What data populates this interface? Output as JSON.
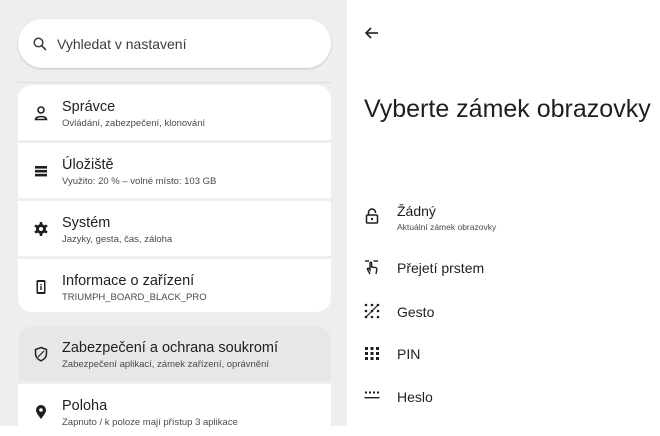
{
  "search": {
    "placeholder": "Vyhledat v nastavení",
    "icon": "search-icon"
  },
  "sidebar": {
    "items": [
      {
        "title": "Správce",
        "subtitle": "Ovládání, zabezpečení, klonování",
        "icon": "person-icon"
      },
      {
        "title": "Úložiště",
        "subtitle": "Využito: 20 % – volné místo: 103 GB",
        "icon": "storage-icon"
      },
      {
        "title": "Systém",
        "subtitle": "Jazyky, gesta, čas, záloha",
        "icon": "gear-icon"
      },
      {
        "title": "Informace o zařízení",
        "subtitle": "TRIUMPH_BOARD_BLACK_PRO",
        "icon": "device-info-icon"
      },
      {
        "title": "Zabezpečení a ochrana soukromí",
        "subtitle": "Zabezpečení aplikací, zámek zařízení, oprávnění",
        "icon": "shield-icon",
        "active": true
      },
      {
        "title": "Poloha",
        "subtitle": "Zapnuto / k poloze mají přístup 3 aplikace",
        "icon": "location-icon"
      }
    ]
  },
  "main": {
    "back_icon": "back-arrow-icon",
    "title": "Vyberte zámek obrazovky",
    "options": [
      {
        "title": "Žádný",
        "subtitle": "Aktuální zámek obrazovky",
        "icon": "unlocked-icon"
      },
      {
        "title": "Přejetí prstem",
        "icon": "swipe-icon"
      },
      {
        "title": "Gesto",
        "icon": "pattern-icon"
      },
      {
        "title": "PIN",
        "icon": "pin-icon"
      },
      {
        "title": "Heslo",
        "icon": "password-icon"
      }
    ]
  }
}
